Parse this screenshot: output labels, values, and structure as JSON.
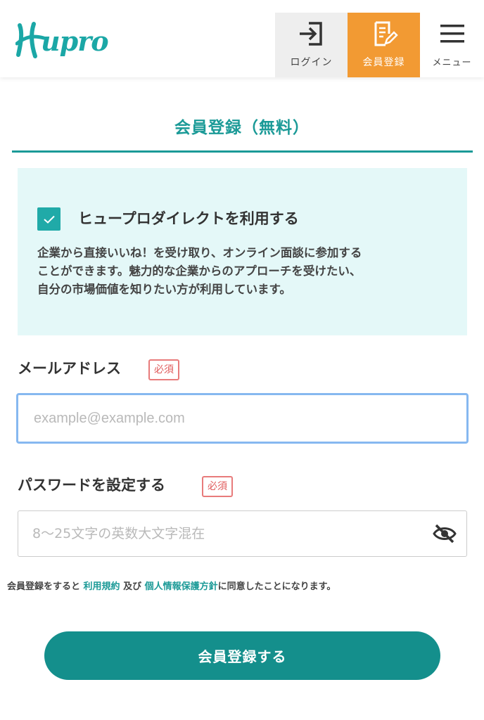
{
  "header": {
    "logo_text": "upro",
    "logo_full": "Hupro",
    "nav": {
      "login_label": "ログイン",
      "register_label": "会員登録",
      "menu_label": "メニュー"
    }
  },
  "section": {
    "title": "会員登録（無料）"
  },
  "direct": {
    "checkbox_label": "ヒュープロダイレクトを利用する",
    "checked": true,
    "description_lines": [
      "企業から直接いいね！を受け取り、オンライン面談に参加する",
      "ことができます。魅力的な企業からのアプローチを受けたい、",
      "自分の市場価値を知りたい方が利用しています。"
    ]
  },
  "email": {
    "label": "メールアドレス",
    "required_badge": "必須",
    "value": "",
    "placeholder": "example@example.com"
  },
  "password": {
    "label": "パスワードを設定する",
    "required_badge": "必須",
    "value": "",
    "placeholder": "8〜25文字の英数大文字混在",
    "visibility_icon": "eye-slash-icon"
  },
  "agreement": {
    "prefix": "会員登録をすると ",
    "terms_link": "利用規約",
    "middle": " 及び ",
    "privacy_link": "個人情報保護方針",
    "suffix": "に同意したことになります。"
  },
  "submit": {
    "label": "会員登録する"
  },
  "colors": {
    "brand_teal": "#1b9a97",
    "register_orange": "#f29a33",
    "info_bg": "#e4f8f8",
    "required_red": "#e05a5a",
    "focus_blue": "#86b8f0"
  }
}
